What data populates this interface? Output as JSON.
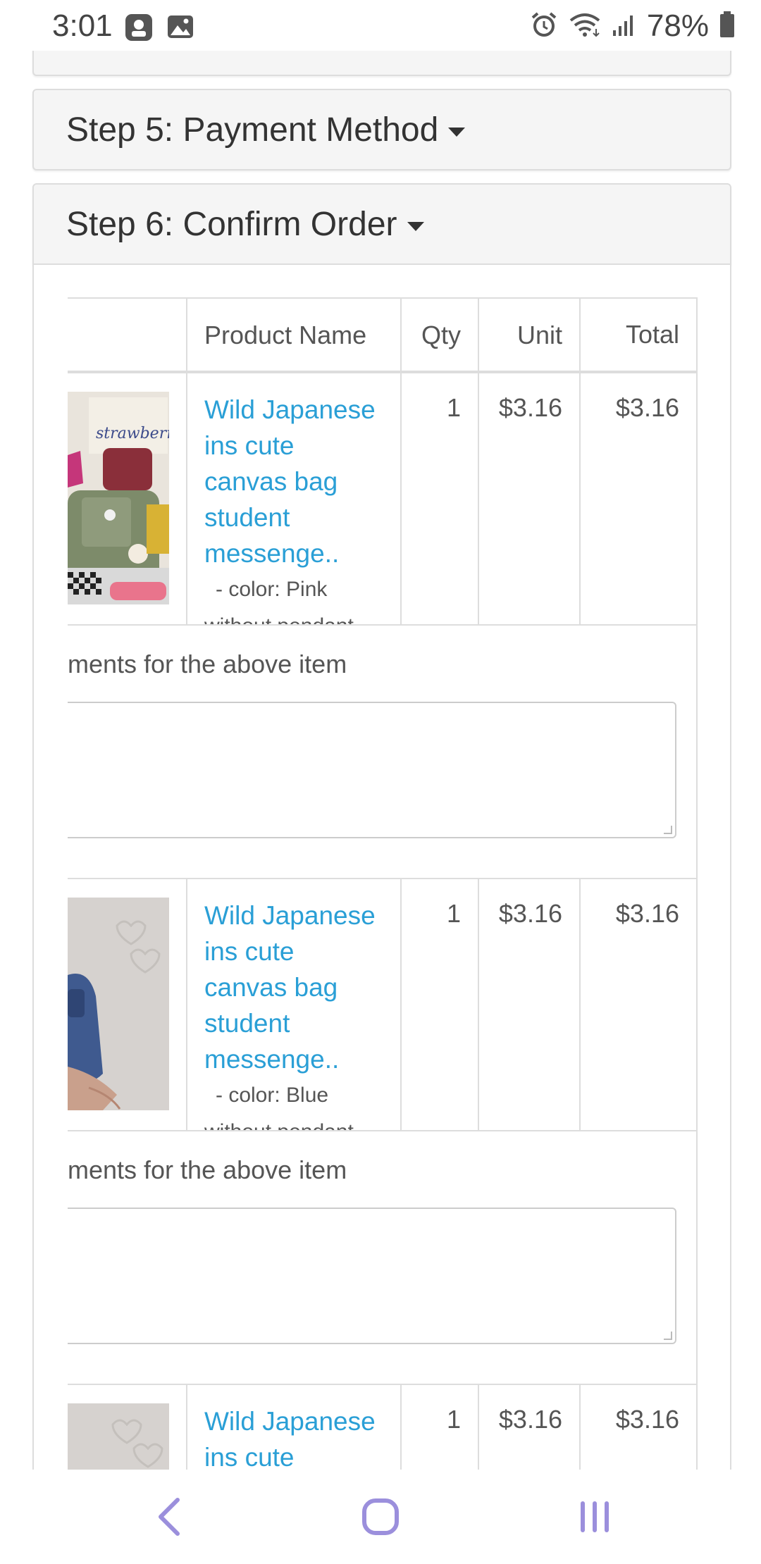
{
  "status_bar": {
    "time": "3:01",
    "battery": "78%",
    "icons": [
      "notification-icon",
      "image-icon",
      "alarm-icon",
      "wifi-icon",
      "signal-icon",
      "battery-icon"
    ]
  },
  "panels": {
    "step5": {
      "title": "Step 5: Payment Method"
    },
    "step6": {
      "title": "Step 6: Confirm Order"
    }
  },
  "table": {
    "headers": {
      "image": "",
      "name": "Product Name",
      "qty": "Qty",
      "unit": "Unit",
      "total": "Total"
    },
    "rows": [
      {
        "name": "Wild Japanese ins cute canvas bag student messenge..",
        "option_line1": "- color: Pink",
        "option_line2": "without pendant",
        "qty": "1",
        "unit": "$3.16",
        "total": "$3.16",
        "comment_label": "ments for the above item"
      },
      {
        "name": "Wild Japanese ins cute canvas bag student messenge..",
        "option_line1": "- color: Blue",
        "option_line2": "without pendant",
        "qty": "1",
        "unit": "$3.16",
        "total": "$3.16",
        "comment_label": "ments for the above item"
      },
      {
        "name": "Wild Japanese ins cute canvas",
        "qty": "1",
        "unit": "$3.16",
        "total": "$3.16"
      }
    ]
  },
  "colors": {
    "link": "#2a9fd6",
    "panel_bg": "#f5f5f5",
    "border": "#dddddd",
    "nav_icon": "#9b8fdc"
  }
}
